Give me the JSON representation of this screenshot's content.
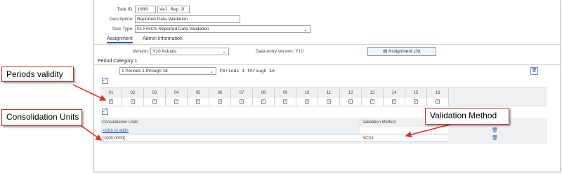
{
  "header": {
    "task_id_label": "Task ID:",
    "task_id_value": "1080",
    "task_code_value": "Val.Rep.D",
    "description_label": "Description:",
    "description_value": "Reported Data Validation",
    "task_type_label": "Task Type:",
    "task_type_value": "01 FINCS Reported Data Validation"
  },
  "tabs": [
    {
      "label": "Assignment",
      "active": true
    },
    {
      "label": "Admin Information",
      "active": false
    }
  ],
  "version": {
    "label": "Version:",
    "value": "Y10 Actuals",
    "data_entry_label": "Data entry version:",
    "data_entry_value": "Y10"
  },
  "assignment_list_button": "Assignment List",
  "period_category": {
    "label": "Period Category 1",
    "select_value": "1 Periods 1 through 16",
    "text": "Periods 1 through 16"
  },
  "periods": [
    "01",
    "02",
    "03",
    "04",
    "05",
    "06",
    "07",
    "08",
    "09",
    "10",
    "11",
    "12",
    "13",
    "14",
    "15",
    "16"
  ],
  "period_checked": true,
  "units_table": {
    "col_units": "Consolidation Units",
    "col_method": "Validation Method",
    "add_link": "<click to add>",
    "rows": [
      {
        "unit": "[1000,0000]",
        "method": "SCD1"
      }
    ]
  },
  "callouts": {
    "periods_validity": "Periods validity",
    "consolidation_units": "Consolidation Units",
    "validation_method": "Validation Method"
  },
  "colors": {
    "accent": "#2a5db0",
    "callout_border": "#c0392b",
    "callout_arrow": "#e03020"
  }
}
